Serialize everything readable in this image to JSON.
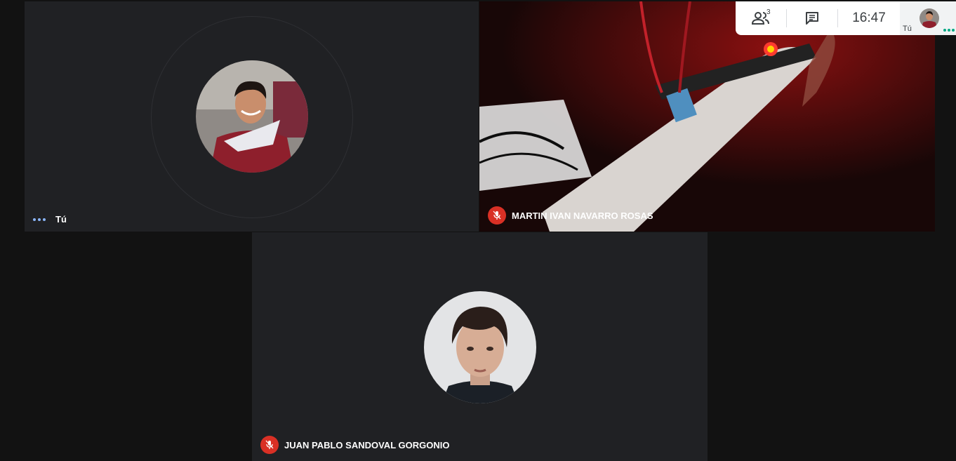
{
  "participants": {
    "self": {
      "name": "Tú"
    },
    "video": {
      "name": "MARTIN IVAN NAVARRO ROSAS"
    },
    "juan": {
      "name": "JUAN PABLO SANDOVAL GORGONIO"
    }
  },
  "top_panel": {
    "people_count": "3",
    "time": "16:47",
    "self_label": "Tú"
  },
  "icons": {
    "people": "people-icon",
    "chat": "chat-icon",
    "mic_off": "mic-off-icon"
  },
  "colors": {
    "tile_bg": "#202124",
    "page_bg": "#121212",
    "mic_off_red": "#d93025",
    "speaking_dots": "#8ab4f8"
  }
}
